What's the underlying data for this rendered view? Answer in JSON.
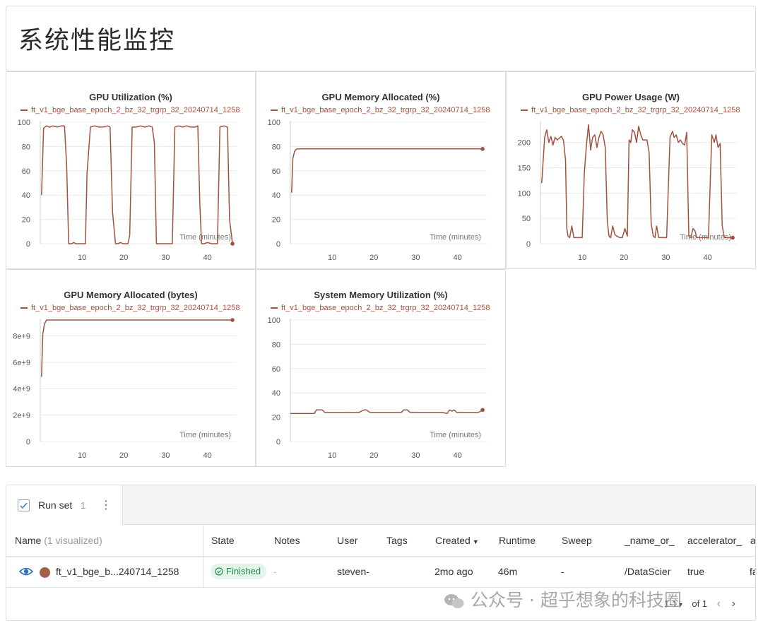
{
  "page_title": "系统性能监控",
  "colors": {
    "series": "#a0523f",
    "grid": "#ececec",
    "axis": "#cccccc"
  },
  "charts": [
    {
      "id": "gpu-util",
      "title": "GPU Utilization (%)",
      "legend": "ft_v1_bge_base_epoch_2_bz_32_trgrp_32_20240714_1258",
      "xlabel": "Time (minutes)",
      "yticks": [
        "0",
        "20",
        "40",
        "60",
        "80",
        "100"
      ],
      "xticks": [
        "10",
        "20",
        "30",
        "40"
      ]
    },
    {
      "id": "gpu-mem-pct",
      "title": "GPU Memory Allocated (%)",
      "legend": "ft_v1_bge_base_epoch_2_bz_32_trgrp_32_20240714_1258",
      "xlabel": "Time (minutes)",
      "yticks": [
        "0",
        "20",
        "40",
        "60",
        "80",
        "100"
      ],
      "xticks": [
        "10",
        "20",
        "30",
        "40"
      ]
    },
    {
      "id": "gpu-power",
      "title": "GPU Power Usage (W)",
      "legend": "ft_v1_bge_base_epoch_2_bz_32_trgrp_32_20240714_1258",
      "xlabel": "Time (minutes)",
      "yticks": [
        "0",
        "50",
        "100",
        "150",
        "200"
      ],
      "xticks": [
        "10",
        "20",
        "30",
        "40"
      ]
    },
    {
      "id": "gpu-mem-bytes",
      "title": "GPU Memory Allocated (bytes)",
      "legend": "ft_v1_bge_base_epoch_2_bz_32_trgrp_32_20240714_1258",
      "xlabel": "Time (minutes)",
      "yticks": [
        "0",
        "2e+9",
        "4e+9",
        "6e+9",
        "8e+9"
      ],
      "xticks": [
        "10",
        "20",
        "30",
        "40"
      ]
    },
    {
      "id": "sys-mem",
      "title": "System Memory Utilization (%)",
      "legend": "ft_v1_bge_base_epoch_2_bz_32_trgrp_32_20240714_1258",
      "xlabel": "Time (minutes)",
      "yticks": [
        "0",
        "20",
        "40",
        "60",
        "80",
        "100"
      ],
      "xticks": [
        "10",
        "20",
        "30",
        "40"
      ]
    }
  ],
  "chart_data": [
    {
      "type": "line",
      "title": "GPU Utilization (%)",
      "xlabel": "Time (minutes)",
      "ylabel": "",
      "xlim": [
        0,
        47
      ],
      "ylim": [
        0,
        100
      ],
      "series": [
        {
          "name": "ft_v1_bge_base_epoch_2_bz_32_trgrp_32_20240714_1258",
          "x": [
            0.3,
            0.8,
            1.5,
            2.2,
            3,
            4,
            5,
            5.8,
            6.3,
            6.8,
            7.5,
            8,
            8.5,
            9.5,
            10.2,
            10.8,
            11.2,
            12,
            13,
            14,
            15,
            16.2,
            16.7,
            17.3,
            18,
            18.5,
            19.2,
            19.8,
            20.5,
            21,
            21.4,
            22,
            23,
            24,
            25,
            26,
            26.8,
            27.3,
            27.8,
            28.5,
            29.5,
            30.5,
            31.2,
            31.6,
            32.2,
            33,
            34,
            35,
            36,
            37,
            37.7,
            38.2,
            38.6,
            39.2,
            40,
            41,
            41.8,
            42.4,
            43,
            44,
            44.8,
            45.3,
            46
          ],
          "y": [
            40,
            95,
            97,
            96,
            97,
            96,
            97,
            97,
            65,
            0,
            0,
            1,
            0,
            0,
            0,
            0,
            58,
            96,
            97,
            96,
            96,
            97,
            96,
            26,
            0,
            0,
            1,
            0,
            0,
            0,
            7,
            96,
            96,
            97,
            96,
            97,
            96,
            83,
            0,
            0,
            0,
            0,
            0,
            0,
            96,
            97,
            96,
            97,
            96,
            96,
            97,
            32,
            0,
            0,
            1,
            0,
            0,
            0,
            96,
            97,
            96,
            20,
            0
          ]
        }
      ]
    },
    {
      "type": "line",
      "title": "GPU Memory Allocated (%)",
      "xlabel": "Time (minutes)",
      "ylabel": "",
      "xlim": [
        0,
        47
      ],
      "ylim": [
        0,
        100
      ],
      "series": [
        {
          "name": "ft_v1_bge_base_epoch_2_bz_32_trgrp_32_20240714_1258",
          "x": [
            0.3,
            0.6,
            1,
            1.5,
            3,
            10,
            20,
            30,
            40,
            46
          ],
          "y": [
            42,
            70,
            76,
            78,
            78,
            78,
            78,
            78,
            78,
            78
          ]
        }
      ]
    },
    {
      "type": "line",
      "title": "GPU Power Usage (W)",
      "xlabel": "Time (minutes)",
      "ylabel": "",
      "xlim": [
        0,
        47
      ],
      "ylim": [
        0,
        240
      ],
      "series": [
        {
          "name": "ft_v1_bge_base_epoch_2_bz_32_trgrp_32_20240714_1258",
          "x": [
            0.3,
            1,
            1.5,
            2,
            2.5,
            3,
            3.5,
            4,
            5,
            5.5,
            6,
            6.3,
            6.6,
            7,
            7.5,
            8,
            8.5,
            9,
            10,
            10.5,
            11,
            11.5,
            12,
            12.5,
            13,
            13.5,
            14,
            14.5,
            15,
            15.5,
            16,
            16.4,
            16.8,
            17.3,
            17.8,
            18.3,
            19,
            19.6,
            20.2,
            20.8,
            21.2,
            21.6,
            22,
            22.5,
            23,
            23.5,
            24,
            24.5,
            25,
            25.5,
            26,
            26.5,
            27,
            27.4,
            27.8,
            28.3,
            28.8,
            29.2,
            29.6,
            30.2,
            31,
            31.6,
            32,
            32.5,
            33,
            33.5,
            34,
            34.5,
            35,
            35.5,
            36,
            36.5,
            37,
            37.4,
            37.8,
            38.3,
            38.8,
            39.2,
            39.6,
            40.2,
            41,
            41.6,
            42,
            42.5,
            43,
            43.5,
            44,
            44.5,
            45,
            45.5,
            46
          ],
          "y": [
            120,
            210,
            225,
            200,
            212,
            195,
            210,
            205,
            212,
            205,
            165,
            30,
            15,
            12,
            35,
            12,
            12,
            12,
            12,
            140,
            195,
            235,
            185,
            210,
            215,
            190,
            210,
            222,
            215,
            190,
            45,
            15,
            12,
            35,
            18,
            15,
            12,
            12,
            30,
            15,
            205,
            200,
            225,
            220,
            200,
            232,
            215,
            205,
            205,
            205,
            180,
            40,
            15,
            12,
            35,
            12,
            12,
            12,
            12,
            12,
            210,
            222,
            210,
            215,
            200,
            205,
            198,
            195,
            220,
            15,
            12,
            30,
            25,
            12,
            12,
            12,
            12,
            12,
            12,
            12,
            215,
            200,
            215,
            190,
            198,
            35,
            12,
            12,
            12,
            12,
            12
          ],
          "end_point": 12
        }
      ]
    },
    {
      "type": "line",
      "title": "GPU Memory Allocated (bytes)",
      "xlabel": "Time (minutes)",
      "ylabel": "",
      "xlim": [
        0,
        47
      ],
      "ylim": [
        0,
        9200000000.0
      ],
      "series": [
        {
          "name": "ft_v1_bge_base_epoch_2_bz_32_trgrp_32_20240714_1258",
          "x": [
            0.3,
            0.6,
            1,
            1.5,
            3,
            10,
            20,
            30,
            40,
            46
          ],
          "y": [
            4900000000.0,
            8100000000.0,
            8900000000.0,
            9200000000.0,
            9200000000.0,
            9200000000.0,
            9200000000.0,
            9200000000.0,
            9200000000.0,
            9200000000.0
          ]
        }
      ]
    },
    {
      "type": "line",
      "title": "System Memory Utilization (%)",
      "xlabel": "Time (minutes)",
      "ylabel": "",
      "xlim": [
        0,
        47
      ],
      "ylim": [
        0,
        100
      ],
      "series": [
        {
          "name": "ft_v1_bge_base_epoch_2_bz_32_trgrp_32_20240714_1258",
          "x": [
            0,
            2,
            4,
            5,
            5.7,
            6.2,
            7,
            7.6,
            8.2,
            9,
            12,
            15,
            16.5,
            17,
            17.6,
            18.2,
            19,
            22,
            25,
            26,
            26.6,
            27.1,
            28,
            28.6,
            29.2,
            30,
            33,
            36,
            37,
            37.5,
            38.1,
            38.7,
            39.2,
            39.8,
            42,
            45,
            45.6,
            46
          ],
          "y": [
            23,
            23,
            23,
            23,
            23,
            26,
            26,
            26,
            24,
            24,
            24,
            24,
            24,
            25,
            26,
            26,
            24,
            24,
            24,
            24,
            24,
            26,
            26,
            24,
            24,
            24,
            24,
            24,
            23.5,
            23,
            26,
            25,
            26,
            24,
            24,
            24,
            25,
            26
          ]
        }
      ]
    }
  ],
  "runs": {
    "runset_label": "Run set",
    "runset_count": "1",
    "columns": {
      "name": "Name",
      "name_suffix": "(1 visualized)",
      "state": "State",
      "notes": "Notes",
      "user": "User",
      "tags": "Tags",
      "created": "Created",
      "runtime": "Runtime",
      "sweep": "Sweep",
      "name_or": "_name_or_",
      "accelerator": "accelerator_",
      "extra": "a"
    },
    "row": {
      "name": "ft_v1_bge_b...240714_1258",
      "state": "Finished",
      "notes": "-",
      "user": "steven-",
      "tags": "",
      "created": "2mo ago",
      "runtime": "46m",
      "sweep": "-",
      "name_or": "/DataScier",
      "accelerator": "true",
      "extra": "fa"
    },
    "pager": {
      "range": "1-1",
      "of": "of 1"
    }
  },
  "watermark": "公众号 · 超乎想象的科技圈"
}
